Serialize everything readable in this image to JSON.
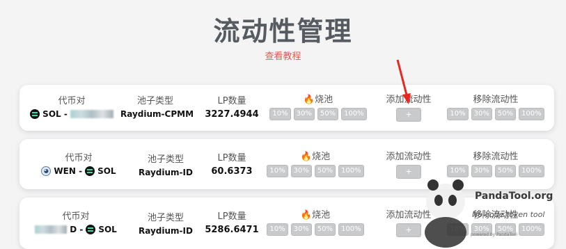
{
  "page": {
    "title": "流动性管理",
    "tutorial_link": "查看教程"
  },
  "headers": {
    "pair": "代币对",
    "pool_type": "池子类型",
    "lp_amount": "LP数量",
    "burn": "🔥烧池",
    "add_liquidity": "添加流动性",
    "remove_liquidity": "移除流动性"
  },
  "percent_buttons": [
    "10%",
    "30%",
    "50%",
    "100%"
  ],
  "add_button_label": "+",
  "rows": [
    {
      "pair_text": "SOL -",
      "pool_type": "Raydium-CPMM",
      "lp": "3227.4944"
    },
    {
      "pair_text": "WEN - ",
      "pair_text2": "SOL",
      "pool_type": "Raydium-ID",
      "lp": "60.6373"
    },
    {
      "pair_text": "D - ",
      "pair_text2": "SOL",
      "pool_type": "Raydium-ID",
      "lp": "5286.6471"
    }
  ],
  "watermark": {
    "brand": "PandaTool.org",
    "tagline": "No-code token tool",
    "small": "powered by PandaTool"
  },
  "colors": {
    "title": "#555b61",
    "link": "#e05a4f",
    "button_disabled": "#c8cacc",
    "arrow": "#e8271f"
  }
}
